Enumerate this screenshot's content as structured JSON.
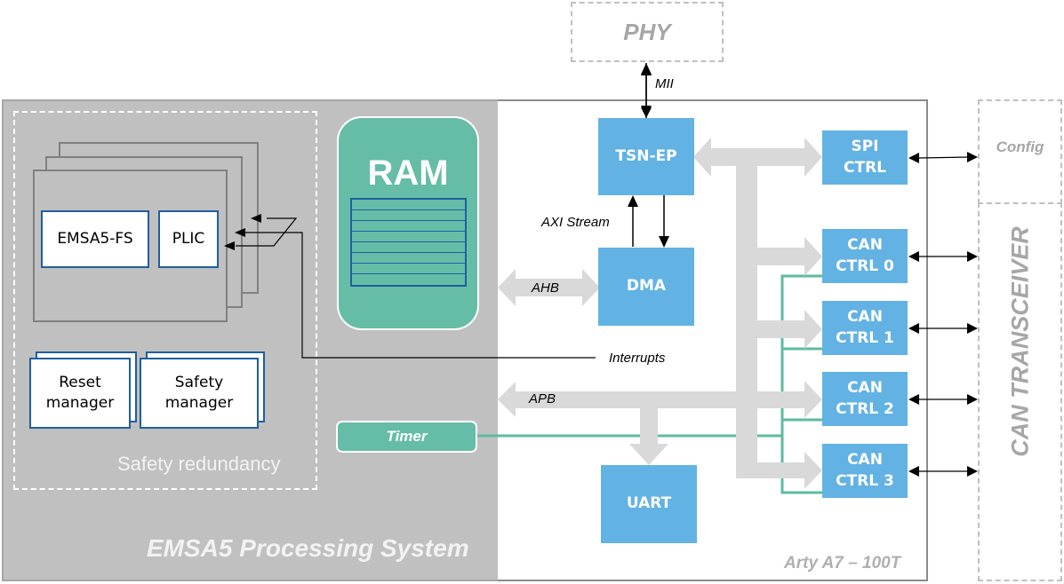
{
  "external": {
    "phy": "PHY",
    "config": "Config",
    "can_transceiver": "CAN TRANSCEIVER"
  },
  "board": {
    "label": "Arty A7 – 100T"
  },
  "processing_system": {
    "label": "EMSA5 Processing System",
    "safety_redundancy": {
      "label": "Safety redundancy",
      "core": "EMSA5-FS",
      "plic": "PLIC",
      "reset_manager": "Reset manager",
      "safety_manager": "Safety manager"
    },
    "ram": "RAM",
    "timer": "Timer"
  },
  "peripherals": {
    "tsn_ep": "TSN-EP",
    "dma": "DMA",
    "uart": "UART",
    "spi_ctrl": [
      "SPI",
      "CTRL"
    ],
    "can_ctrls": [
      [
        "CAN",
        "CTRL 0"
      ],
      [
        "CAN",
        "CTRL 1"
      ],
      [
        "CAN",
        "CTRL 2"
      ],
      [
        "CAN",
        "CTRL 3"
      ]
    ]
  },
  "connections": {
    "mii": "MII",
    "axi_stream": "AXI Stream",
    "ahb": "AHB",
    "apb": "APB",
    "interrupts": "Interrupts"
  },
  "colors": {
    "peripheral_blue": "#63b2e4",
    "memory_green": "#66bda7",
    "bus_grey": "#d9d9d9",
    "ps_grey": "#c0c0c0",
    "dashed_grey": "#c0c0c0"
  }
}
